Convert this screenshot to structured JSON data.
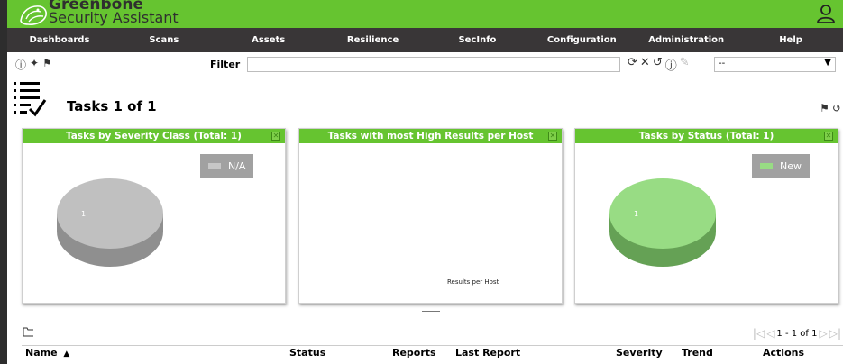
{
  "brand": {
    "line1": "Greenbone",
    "line2": "Security Assistant"
  },
  "nav": [
    "Dashboards",
    "Scans",
    "Assets",
    "Resilience",
    "SecInfo",
    "Configuration",
    "Administration",
    "Help"
  ],
  "toolbar": {
    "filter_label": "Filter",
    "filter_value": "",
    "filter_select_value": "--"
  },
  "page": {
    "title": "Tasks 1 of 1"
  },
  "panels": [
    {
      "title": "Tasks by Severity Class (Total: 1)",
      "legend": "N/A",
      "slice_label": "1",
      "color": "#c0c0c0",
      "shade": "#8f8f8f"
    },
    {
      "title": "Tasks with most High Results per Host",
      "caption": "Results per Host"
    },
    {
      "title": "Tasks by Status (Total: 1)",
      "legend": "New",
      "slice_label": "1",
      "color": "#98dc84",
      "shade": "#65a155"
    }
  ],
  "pagination": {
    "text": "1 - 1 of 1"
  },
  "table": {
    "columns": [
      "Name",
      "Status",
      "Reports",
      "Last Report",
      "Severity",
      "Trend",
      "Actions"
    ],
    "sort_indicator": "▲"
  },
  "colors": {
    "accent": "#66c430",
    "nav_bg": "#393637"
  }
}
